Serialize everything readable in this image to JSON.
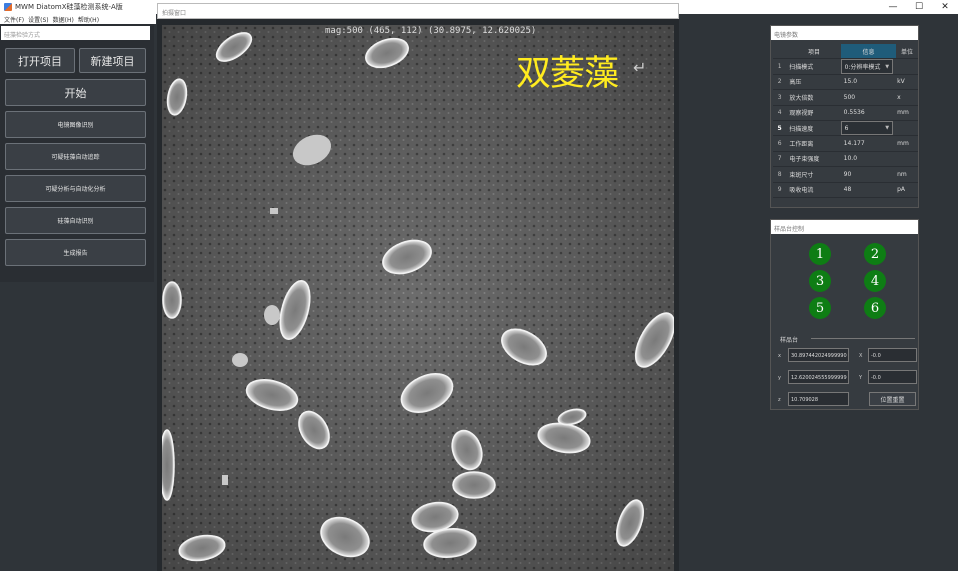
{
  "window": {
    "title": "MWM DiatomX硅藻检测系统-A版",
    "minimize": "—",
    "maximize": "☐",
    "close": "✕"
  },
  "menu": [
    "文件(F)",
    "设置(S)",
    "数据(H)",
    "帮助(H)"
  ],
  "left": {
    "search_placeholder": "硅藻检验方式",
    "open_project": "打开项目",
    "new_project": "新建项目",
    "start": "开始",
    "actions": [
      "电镜图像识别",
      "可疑硅藻自动追踪",
      "可疑分析与自动化分析",
      "硅藻自动识别",
      "生成报告"
    ]
  },
  "image": {
    "header": "拍摄窗口",
    "mag_text": "mag:500 (465, 112) (30.8975, 12.620025)",
    "species": "双菱藻",
    "enter_glyph": "↵"
  },
  "params": {
    "title": "电镜参数",
    "headers": [
      "项目",
      "信息",
      "单位"
    ],
    "rows": [
      {
        "n": "1",
        "name": "扫描模式",
        "value": "0:分辨率模式",
        "unit": "",
        "dropdown": true
      },
      {
        "n": "2",
        "name": "高压",
        "value": "15.0",
        "unit": "kV"
      },
      {
        "n": "3",
        "name": "放大倍数",
        "value": "500",
        "unit": "x"
      },
      {
        "n": "4",
        "name": "观察视野",
        "value": "0.5536",
        "unit": "mm"
      },
      {
        "n": "5",
        "name": "扫描速度",
        "value": "6",
        "unit": "",
        "dropdown": true,
        "selected": true
      },
      {
        "n": "6",
        "name": "工作距离",
        "value": "14.177",
        "unit": "mm"
      },
      {
        "n": "7",
        "name": "电子束强度",
        "value": "10.0",
        "unit": ""
      },
      {
        "n": "8",
        "name": "束斑尺寸",
        "value": "90",
        "unit": "nm"
      },
      {
        "n": "9",
        "name": "吸收电流",
        "value": "48",
        "unit": "pA"
      }
    ]
  },
  "stage": {
    "title": "样品台控制",
    "positions": [
      "1",
      "2",
      "3",
      "4",
      "5",
      "6"
    ],
    "section": "样品台",
    "x_label": "x",
    "x_value": "30.897442024999990",
    "x_delta": "-0.0",
    "y_label": "y",
    "y_value": "12.620024555999999",
    "y_delta": "-0.0",
    "z_label": "z",
    "z_value": "10.709028",
    "apply": "位置重置",
    "y_delta_label": "Y",
    "x_delta_label": "X"
  }
}
